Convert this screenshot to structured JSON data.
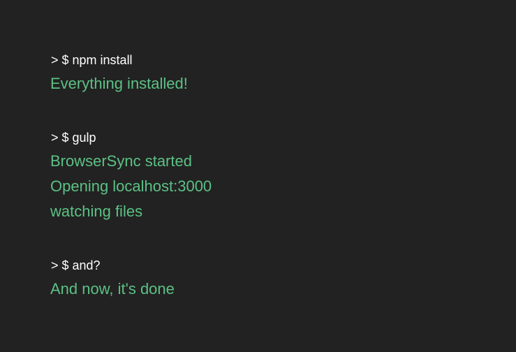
{
  "theme": {
    "background": "#222222",
    "command_color": "#ffffff",
    "output_color": "#5cc185"
  },
  "blocks": [
    {
      "command": "> $ npm install",
      "output": [
        "Everything installed!"
      ]
    },
    {
      "command": "> $ gulp",
      "output": [
        "BrowserSync started",
        "Opening localhost:3000",
        "watching files"
      ]
    },
    {
      "command": "> $ and?",
      "output": [
        "And now, it's done"
      ]
    }
  ]
}
